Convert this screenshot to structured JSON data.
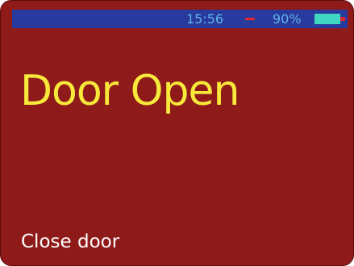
{
  "status_bar": {
    "time": "15:56",
    "separator_color": "#e0262a",
    "battery_percent": "90%",
    "battery_level": 0.9,
    "battery_icon": "battery-icon"
  },
  "screen": {
    "title": "Door Open",
    "action_label": "Close door"
  },
  "colors": {
    "background": "#8f1a1a",
    "status_bar": "#283a9e",
    "status_text": "#5fb3e8",
    "title_text": "#f7e93a",
    "action_text": "#ffffff",
    "battery_fill": "#3fd6c2"
  }
}
